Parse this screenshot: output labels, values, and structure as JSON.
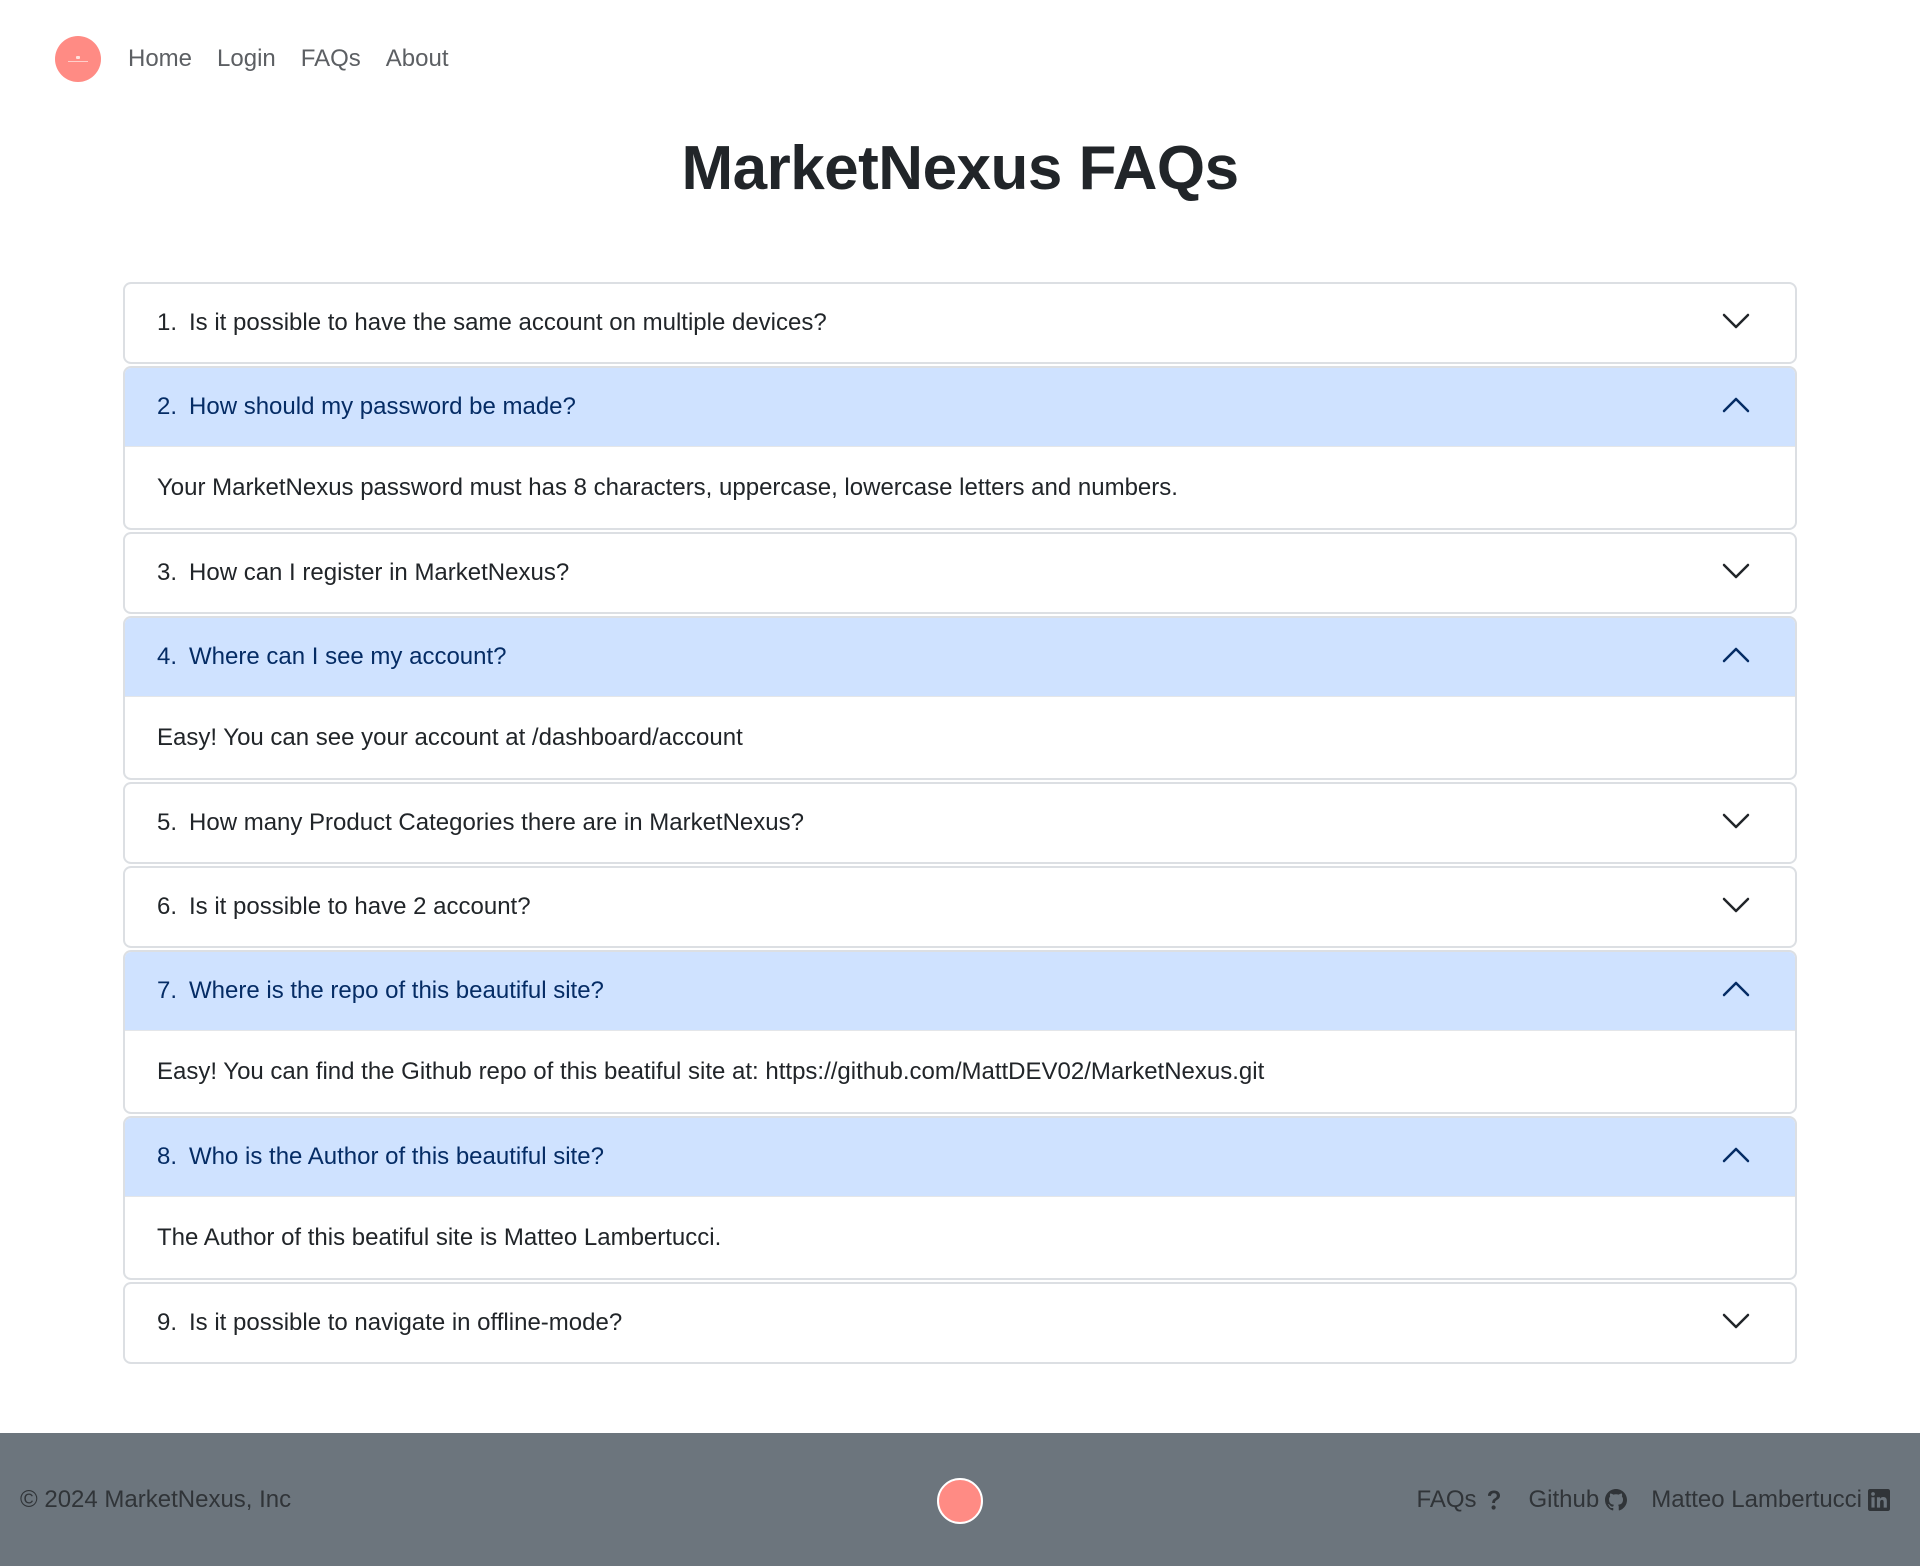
{
  "nav": {
    "items": [
      {
        "label": "Home"
      },
      {
        "label": "Login"
      },
      {
        "label": "FAQs"
      },
      {
        "label": "About"
      }
    ]
  },
  "page": {
    "title": "MarketNexus FAQs"
  },
  "faqs": [
    {
      "num": "1.",
      "question": "Is it possible to have the same account on multiple devices?",
      "open": false,
      "answer": ""
    },
    {
      "num": "2.",
      "question": "How should my password be made?",
      "open": true,
      "answer": "Your MarketNexus password must has 8 characters, uppercase, lowercase letters and numbers."
    },
    {
      "num": "3.",
      "question": "How can I register in MarketNexus?",
      "open": false,
      "answer": ""
    },
    {
      "num": "4.",
      "question": "Where can I see my account?",
      "open": true,
      "answer": "Easy! You can see your account at /dashboard/account"
    },
    {
      "num": "5.",
      "question": "How many Product Categories there are in MarketNexus?",
      "open": false,
      "answer": ""
    },
    {
      "num": "6.",
      "question": "Is it possible to have 2 account?",
      "open": false,
      "answer": ""
    },
    {
      "num": "7.",
      "question": "Where is the repo of this beautiful site?",
      "open": true,
      "answer": "Easy! You can find the Github repo of this beatiful site at: https://github.com/MattDEV02/MarketNexus.git"
    },
    {
      "num": "8.",
      "question": "Who is the Author of this beautiful site?",
      "open": true,
      "answer": "The Author of this beatiful site is Matteo Lambertucci."
    },
    {
      "num": "9.",
      "question": "Is it possible to navigate in offline-mode?",
      "open": false,
      "answer": ""
    }
  ],
  "footer": {
    "copyright": "© 2024 MarketNexus, Inc",
    "links": [
      {
        "label": "FAQs",
        "icon": "question-icon"
      },
      {
        "label": "Github",
        "icon": "github-icon"
      },
      {
        "label": "Matteo Lambertucci",
        "icon": "linkedin-icon"
      }
    ]
  },
  "colors": {
    "accordion_open_bg": "#cfe2ff",
    "accordion_open_text": "#052c65",
    "footer_bg": "#6c757d",
    "logo": "#ff8b84"
  }
}
